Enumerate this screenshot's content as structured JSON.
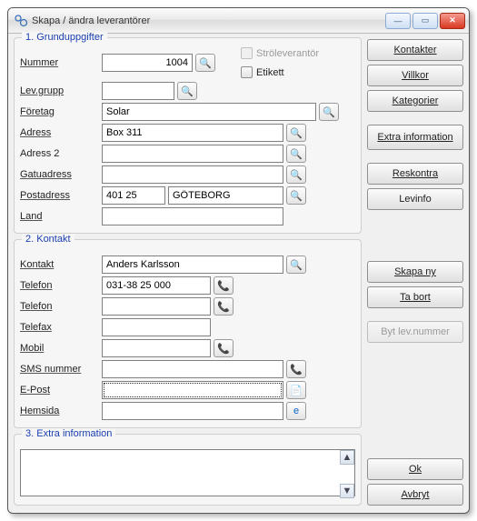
{
  "window": {
    "title": "Skapa / ändra leverantörer"
  },
  "group1": {
    "legend": "1. Grunduppgifter",
    "labels": {
      "nummer": "Nummer",
      "levgrupp": "Lev.grupp",
      "foretag": "Företag",
      "adress": "Adress",
      "adress2": "Adress 2",
      "gatuadress": "Gatuadress",
      "postadress": "Postadress",
      "land": "Land"
    },
    "values": {
      "nummer": "1004",
      "levgrupp": "",
      "foretag": "Solar",
      "adress": "Box 311",
      "adress2": "",
      "gatuadress": "",
      "post_zip": "401 25",
      "post_city": "GÖTEBORG",
      "land": ""
    },
    "checkboxes": {
      "stro": "Ströleverantör",
      "etikett": "Etikett"
    }
  },
  "group2": {
    "legend": "2. Kontakt",
    "labels": {
      "kontakt": "Kontakt",
      "telefon1": "Telefon",
      "telefon2": "Telefon",
      "telefax": "Telefax",
      "mobil": "Mobil",
      "sms": "SMS nummer",
      "epost": "E-Post",
      "hemsida": "Hemsida"
    },
    "values": {
      "kontakt": "Anders Karlsson",
      "telefon1": "031-38 25 000",
      "telefon2": "",
      "telefax": "",
      "mobil": "",
      "sms": "",
      "epost": "",
      "hemsida": ""
    }
  },
  "group3": {
    "legend": "3. Extra information",
    "value": ""
  },
  "sidebar": {
    "kontakter": "Kontakter",
    "villkor": "Villkor",
    "kategorier": "Kategorier",
    "extrainfo": "Extra information",
    "reskontra": "Reskontra",
    "levinfo": "Levinfo",
    "skapany": "Skapa ny",
    "tabort": "Ta bort",
    "bytlev": "Byt lev.nummer",
    "ok": "Ok",
    "avbryt": "Avbryt"
  }
}
